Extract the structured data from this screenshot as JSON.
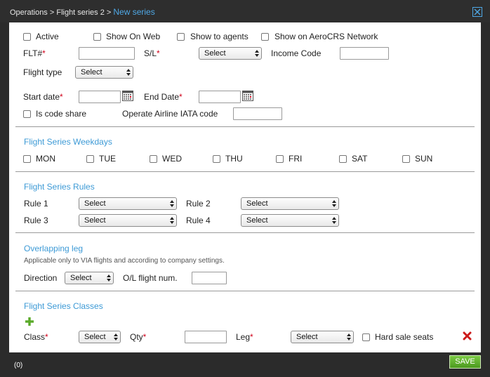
{
  "breadcrumb": {
    "trail": "Operations > Flight series 2 > ",
    "current": "New series"
  },
  "general": {
    "active_label": "Active",
    "show_on_web_label": "Show On Web",
    "show_to_agents_label": "Show to agents",
    "show_on_aerocrs_label": "Show on AeroCRS Network",
    "flt_label": "FLT#",
    "sl_label": "S/L",
    "sl_value": "Select",
    "income_code_label": "Income Code",
    "flight_type_label": "Flight type",
    "flight_type_value": "Select",
    "start_date_label": "Start date",
    "end_date_label": "End Date",
    "code_share_label": "Is code share",
    "operate_airline_label": "Operate Airline IATA code",
    "required_mark": "*"
  },
  "weekdays": {
    "title": "Flight Series Weekdays",
    "days": [
      "MON",
      "TUE",
      "WED",
      "THU",
      "FRI",
      "SAT",
      "SUN"
    ]
  },
  "rules": {
    "title": "Flight Series Rules",
    "items": [
      {
        "label": "Rule 1",
        "value": "Select"
      },
      {
        "label": "Rule 2",
        "value": "Select"
      },
      {
        "label": "Rule 3",
        "value": "Select"
      },
      {
        "label": "Rule 4",
        "value": "Select"
      }
    ]
  },
  "overlapping": {
    "title": "Overlapping leg",
    "note": "Applicable only to VIA flights and according to company settings.",
    "direction_label": "Direction",
    "direction_value": "Select",
    "ol_label": "O/L flight num."
  },
  "classes": {
    "title": "Flight Series Classes",
    "class_label": "Class",
    "class_value": "Select",
    "qty_label": "Qty",
    "leg_label": "Leg",
    "leg_value": "Select",
    "hard_sale_label": "Hard sale seats"
  },
  "footer": {
    "count": "(0)",
    "save_label": "SAVE"
  },
  "colors": {
    "accent": "#3d9ad6",
    "required": "#d0021b",
    "save": "#5aaa2a",
    "delete": "#cc1a1a",
    "add": "#5aaa2a"
  },
  "icons": {
    "close": "close-icon",
    "calendar": "calendar-icon",
    "add": "plus-icon",
    "delete": "x-icon"
  }
}
